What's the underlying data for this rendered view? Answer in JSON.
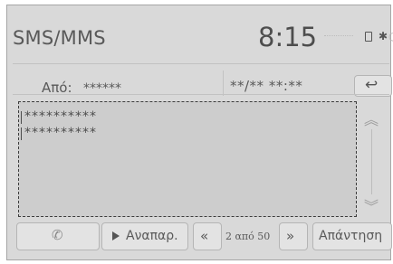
{
  "header": {
    "title": "SMS/MMS",
    "clock": "8:15",
    "status_icons": [
      "sim-icon",
      "bluetooth-icon",
      "wifi-icon"
    ]
  },
  "message": {
    "from_label": "Από:",
    "from_value": "******",
    "date_value": "**/** **:**",
    "body_lines": [
      "**********",
      "**********"
    ]
  },
  "scroll": {
    "up_icon": "≈",
    "down_icon": "≈"
  },
  "toolbar": {
    "call_icon": "phone-icon",
    "play_label": "Αναπαρ.",
    "prev_label": "«",
    "page_indicator": "2 από 50",
    "next_label": "»",
    "reply_label": "Απάντηση"
  },
  "colors": {
    "screen_bg": "#d9d9d9",
    "button_bg": "#e3e3e3",
    "text": "#595959"
  }
}
